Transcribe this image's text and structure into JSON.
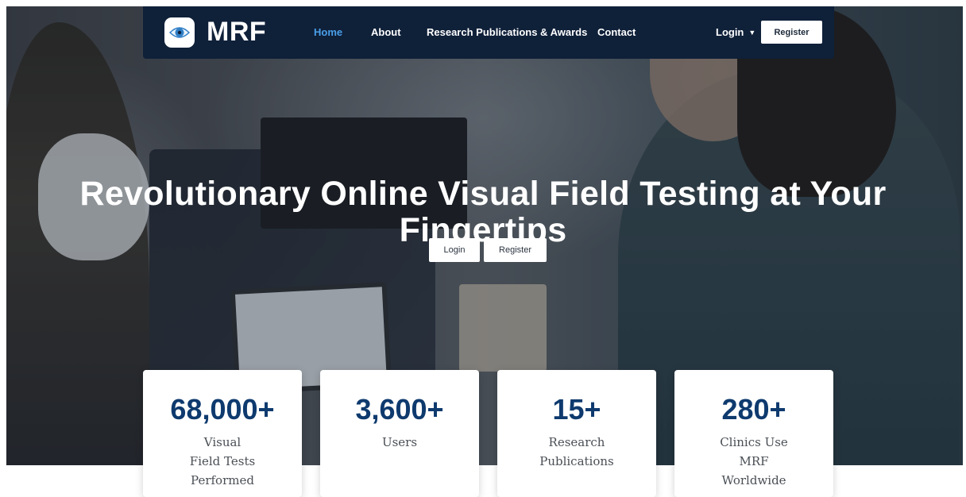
{
  "brand": {
    "name": "MRF",
    "logo_icon": "eye-icon",
    "accent": "#4a9fe8",
    "navbar_bg": "#0f2039"
  },
  "nav": {
    "items": [
      {
        "label": "Home",
        "active": true
      },
      {
        "label": "About"
      },
      {
        "label": "Research Publications & Awards"
      },
      {
        "label": "Contact"
      }
    ],
    "login_label": "Login",
    "login_icon": "chevron-down-icon",
    "register_label": "Register"
  },
  "hero": {
    "headline": "Revolutionary Online Visual Field Testing at Your Fingertips",
    "login_label": "Login",
    "register_label": "Register"
  },
  "stats": [
    {
      "number": "68,000+",
      "label": "Visual Field Tests Performed"
    },
    {
      "number": "3,600+",
      "label": "Users"
    },
    {
      "number": "15+",
      "label": "Research Publications"
    },
    {
      "number": "280+",
      "label": "Clinics Use MRF Worldwide"
    }
  ],
  "colors": {
    "stat_number": "#0e3a6e"
  }
}
